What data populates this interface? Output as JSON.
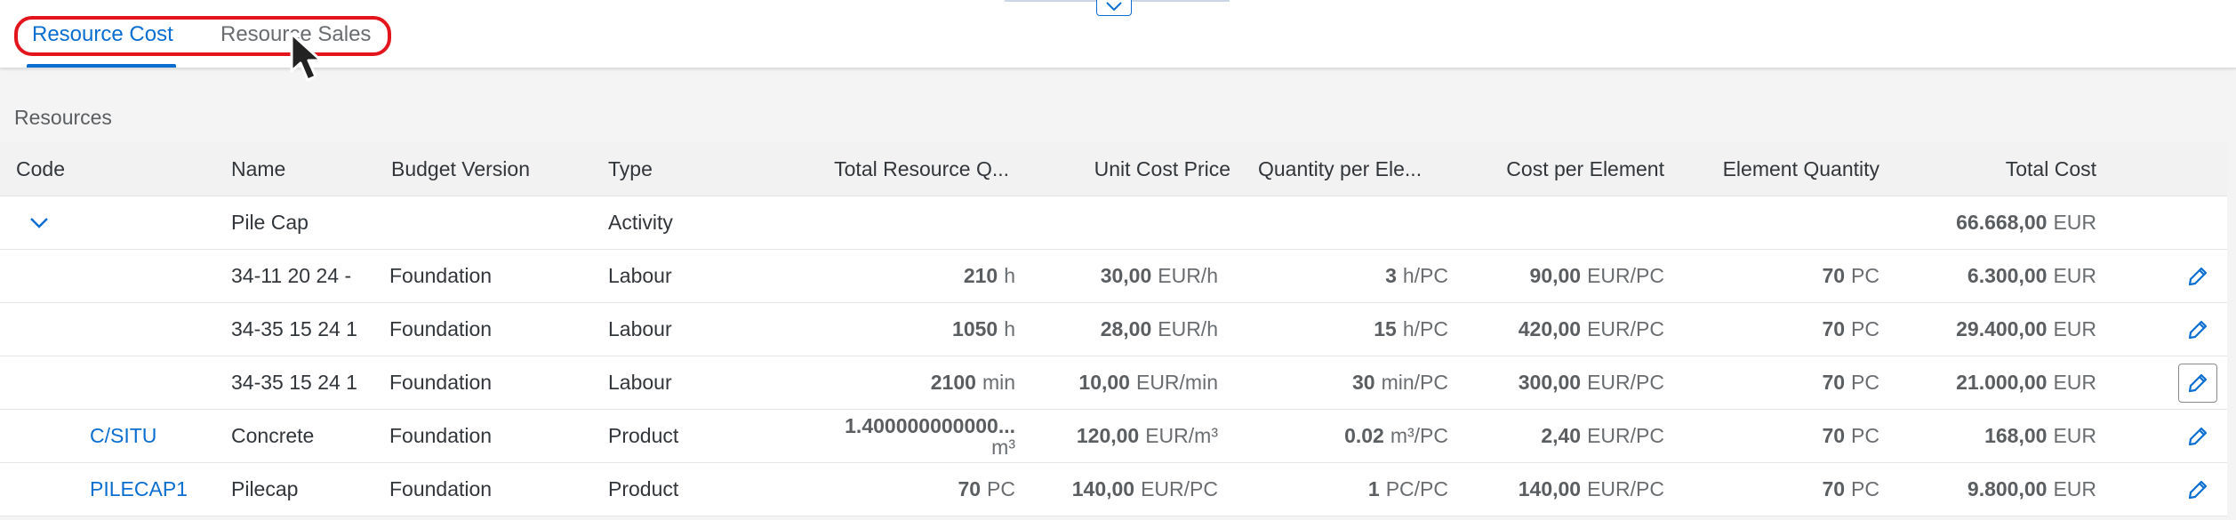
{
  "tabs": [
    {
      "label": "Resource Cost",
      "selected": true
    },
    {
      "label": "Resource Sales",
      "selected": false
    }
  ],
  "section_title": "Resources",
  "columns": {
    "code": "Code",
    "name": "Name",
    "budget_version": "Budget Version",
    "type": "Type",
    "total_qty": "Total Resource Q...",
    "unit_cost": "Unit Cost Price",
    "qty_per_element": "Quantity per Ele...",
    "cost_per_element": "Cost per Element",
    "element_qty": "Element Quantity",
    "total_cost": "Total Cost"
  },
  "group_row": {
    "name": "Pile Cap",
    "type": "Activity",
    "total_cost": "66.668,00",
    "total_cost_unit": "EUR"
  },
  "rows": [
    {
      "code": "",
      "name": "34-11 20 24 -",
      "budget": "Foundation",
      "type": "Labour",
      "total_qty": "210",
      "total_qty_unit": "h",
      "unit_cost": "30,00",
      "unit_cost_unit": "EUR/h",
      "qty_per": "3",
      "qty_per_unit": "h/PC",
      "cost_per": "90,00",
      "cost_per_unit": "EUR/PC",
      "elem_qty": "70",
      "elem_qty_unit": "PC",
      "total_cost": "6.300,00",
      "total_cost_unit": "EUR"
    },
    {
      "code": "",
      "name": "34-35 15 24 1",
      "budget": "Foundation",
      "type": "Labour",
      "total_qty": "1050",
      "total_qty_unit": "h",
      "unit_cost": "28,00",
      "unit_cost_unit": "EUR/h",
      "qty_per": "15",
      "qty_per_unit": "h/PC",
      "cost_per": "420,00",
      "cost_per_unit": "EUR/PC",
      "elem_qty": "70",
      "elem_qty_unit": "PC",
      "total_cost": "29.400,00",
      "total_cost_unit": "EUR"
    },
    {
      "code": "",
      "name": "34-35 15 24 1",
      "budget": "Foundation",
      "type": "Labour",
      "total_qty": "2100",
      "total_qty_unit": "min",
      "unit_cost": "10,00",
      "unit_cost_unit": "EUR/min",
      "qty_per": "30",
      "qty_per_unit": "min/PC",
      "cost_per": "300,00",
      "cost_per_unit": "EUR/PC",
      "elem_qty": "70",
      "elem_qty_unit": "PC",
      "total_cost": "21.000,00",
      "total_cost_unit": "EUR"
    },
    {
      "code": "C/SITU",
      "name": "Concrete",
      "budget": "Foundation",
      "type": "Product",
      "total_qty": "1.400000000000...",
      "total_qty_unit": "m³",
      "unit_cost": "120,00",
      "unit_cost_unit": "EUR/m³",
      "qty_per": "0.02",
      "qty_per_unit": "m³/PC",
      "cost_per": "2,40",
      "cost_per_unit": "EUR/PC",
      "elem_qty": "70",
      "elem_qty_unit": "PC",
      "total_cost": "168,00",
      "total_cost_unit": "EUR"
    },
    {
      "code": "PILECAP1",
      "name": "Pilecap",
      "budget": "Foundation",
      "type": "Product",
      "total_qty": "70",
      "total_qty_unit": "PC",
      "unit_cost": "140,00",
      "unit_cost_unit": "EUR/PC",
      "qty_per": "1",
      "qty_per_unit": "PC/PC",
      "cost_per": "140,00",
      "cost_per_unit": "EUR/PC",
      "elem_qty": "70",
      "elem_qty_unit": "PC",
      "total_cost": "9.800,00",
      "total_cost_unit": "EUR"
    }
  ],
  "colors": {
    "accent": "#0a6ed1",
    "highlight": "#e3141b",
    "text": "#32363a",
    "header_bg": "#f2f2f2",
    "page_bg": "#f4f4f4"
  },
  "icons": {
    "collapse": "chevron-up-icon",
    "expand": "chevron-down-icon",
    "edit": "pencil-icon",
    "cursor": "mouse-pointer-icon"
  }
}
